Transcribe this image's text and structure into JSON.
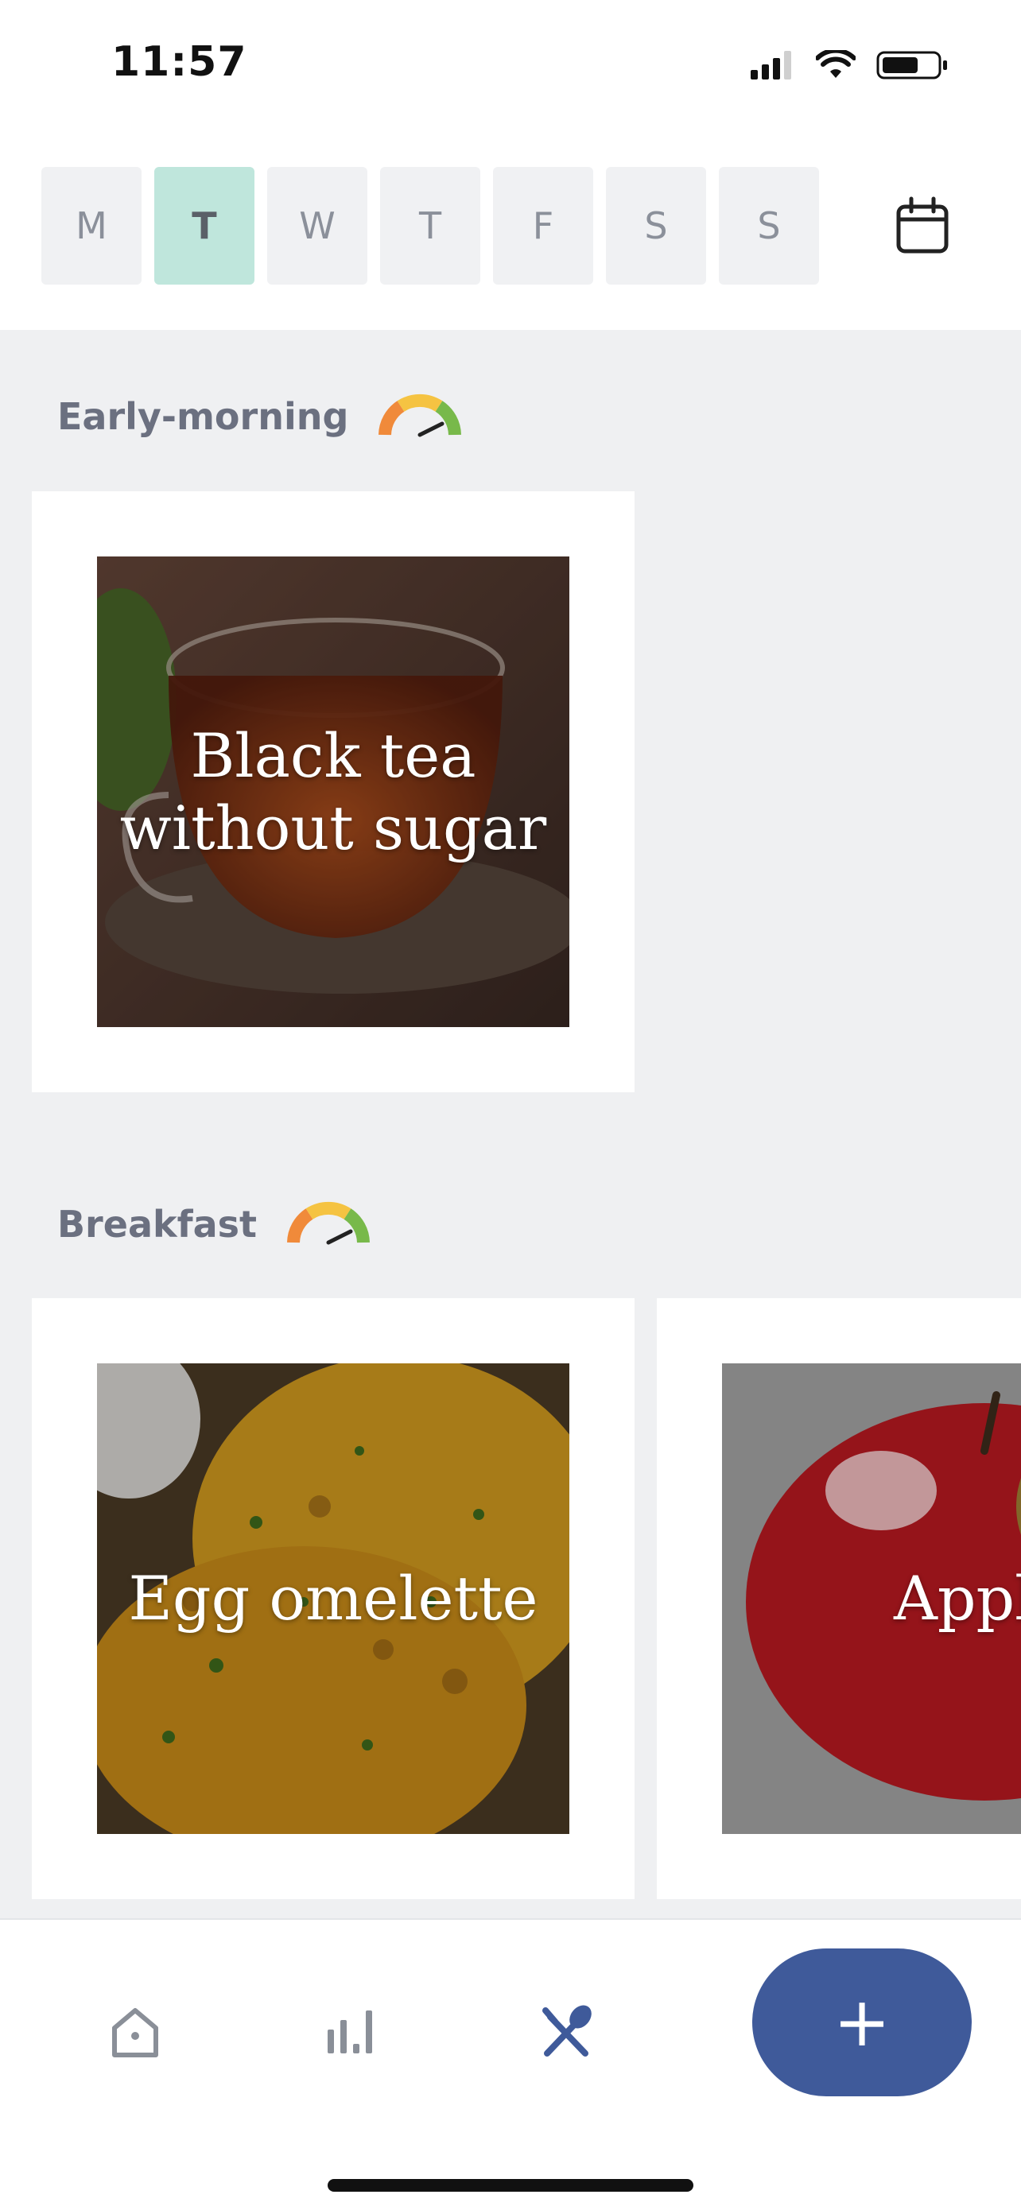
{
  "status_bar": {
    "time": "11:57",
    "icons": [
      "cellular-signal-icon",
      "wifi-icon",
      "battery-icon"
    ]
  },
  "week": {
    "days": [
      {
        "label": "M",
        "selected": false
      },
      {
        "label": "T",
        "selected": true
      },
      {
        "label": "W",
        "selected": false
      },
      {
        "label": "T",
        "selected": false
      },
      {
        "label": "F",
        "selected": false
      },
      {
        "label": "S",
        "selected": false
      },
      {
        "label": "S",
        "selected": false
      }
    ],
    "calendar_icon": "calendar-icon"
  },
  "sections": [
    {
      "title": "Early-morning",
      "gauge_icon": "gauge-meter-icon",
      "items": [
        {
          "label_line1": "Black tea",
          "label_line2": "without sugar"
        }
      ]
    },
    {
      "title": "Breakfast",
      "gauge_icon": "gauge-meter-icon",
      "items": [
        {
          "label": "Egg omelette"
        },
        {
          "label": "Apple"
        }
      ]
    }
  ],
  "nav": {
    "items": [
      "home-icon",
      "stats-icon",
      "meals-icon"
    ],
    "fab_label": "+"
  },
  "colors": {
    "accent": "#3f5a9a",
    "selected_day": "#bfe6dc",
    "content_background": "#eff0f2",
    "day_tile": "#f0f1f3"
  }
}
